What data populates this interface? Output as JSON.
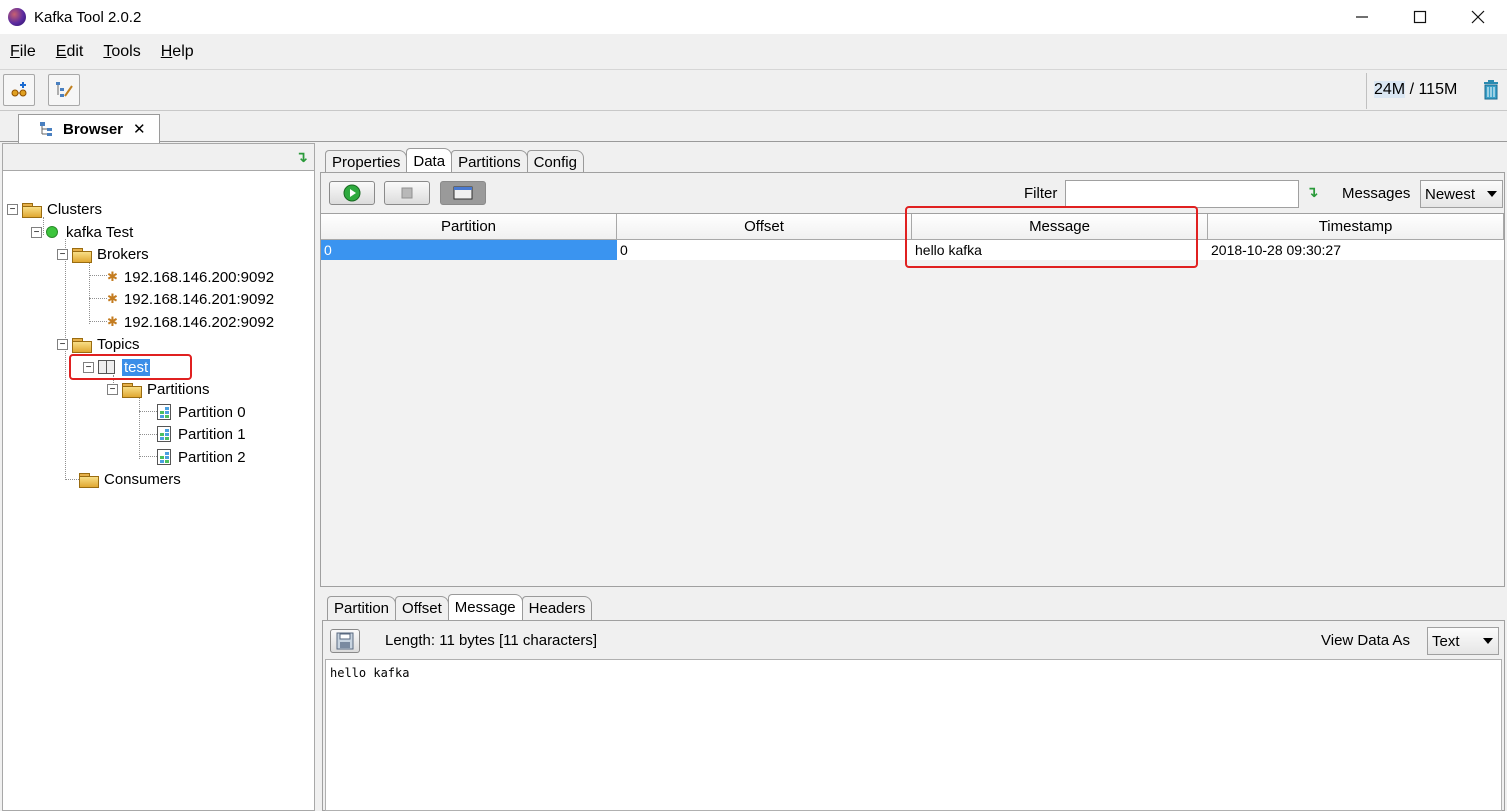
{
  "window": {
    "title": "Kafka Tool  2.0.2"
  },
  "menu": [
    {
      "key": "F",
      "rest": "ile"
    },
    {
      "key": "E",
      "rest": "dit"
    },
    {
      "key": "T",
      "rest": "ools"
    },
    {
      "key": "H",
      "rest": "elp"
    }
  ],
  "memory": {
    "used": "24M",
    "rest": " / 115M"
  },
  "browser_tab": {
    "label": "Browser"
  },
  "tree": {
    "clusters": "Clusters",
    "cluster_name": "kafka Test",
    "brokers": "Brokers",
    "broker_list": [
      "192.168.146.200:9092",
      "192.168.146.201:9092",
      "192.168.146.202:9092"
    ],
    "topics": "Topics",
    "topic": "test",
    "partitions": "Partitions",
    "partition_list": [
      "Partition 0",
      "Partition 1",
      "Partition 2"
    ],
    "consumers": "Consumers"
  },
  "topic_tabs": [
    "Properties",
    "Data",
    "Partitions",
    "Config"
  ],
  "filter": {
    "label": "Filter",
    "value": ""
  },
  "messages": {
    "label": "Messages",
    "selected": "Newest"
  },
  "grid": {
    "columns": [
      "Partition",
      "Offset",
      "Message",
      "Timestamp"
    ],
    "rows": [
      {
        "partition": "0",
        "offset": "0",
        "message": "hello kafka",
        "timestamp": "2018-10-28 09:30:27"
      }
    ]
  },
  "detail_tabs": [
    "Partition",
    "Offset",
    "Message",
    "Headers"
  ],
  "detail": {
    "length": "Length: 11 bytes [11 characters]",
    "view_label": "View Data As",
    "view_selected": "Text",
    "text": "hello kafka"
  },
  "colors": {
    "selection": "#3a94f0",
    "highlight_box": "#e02020"
  }
}
